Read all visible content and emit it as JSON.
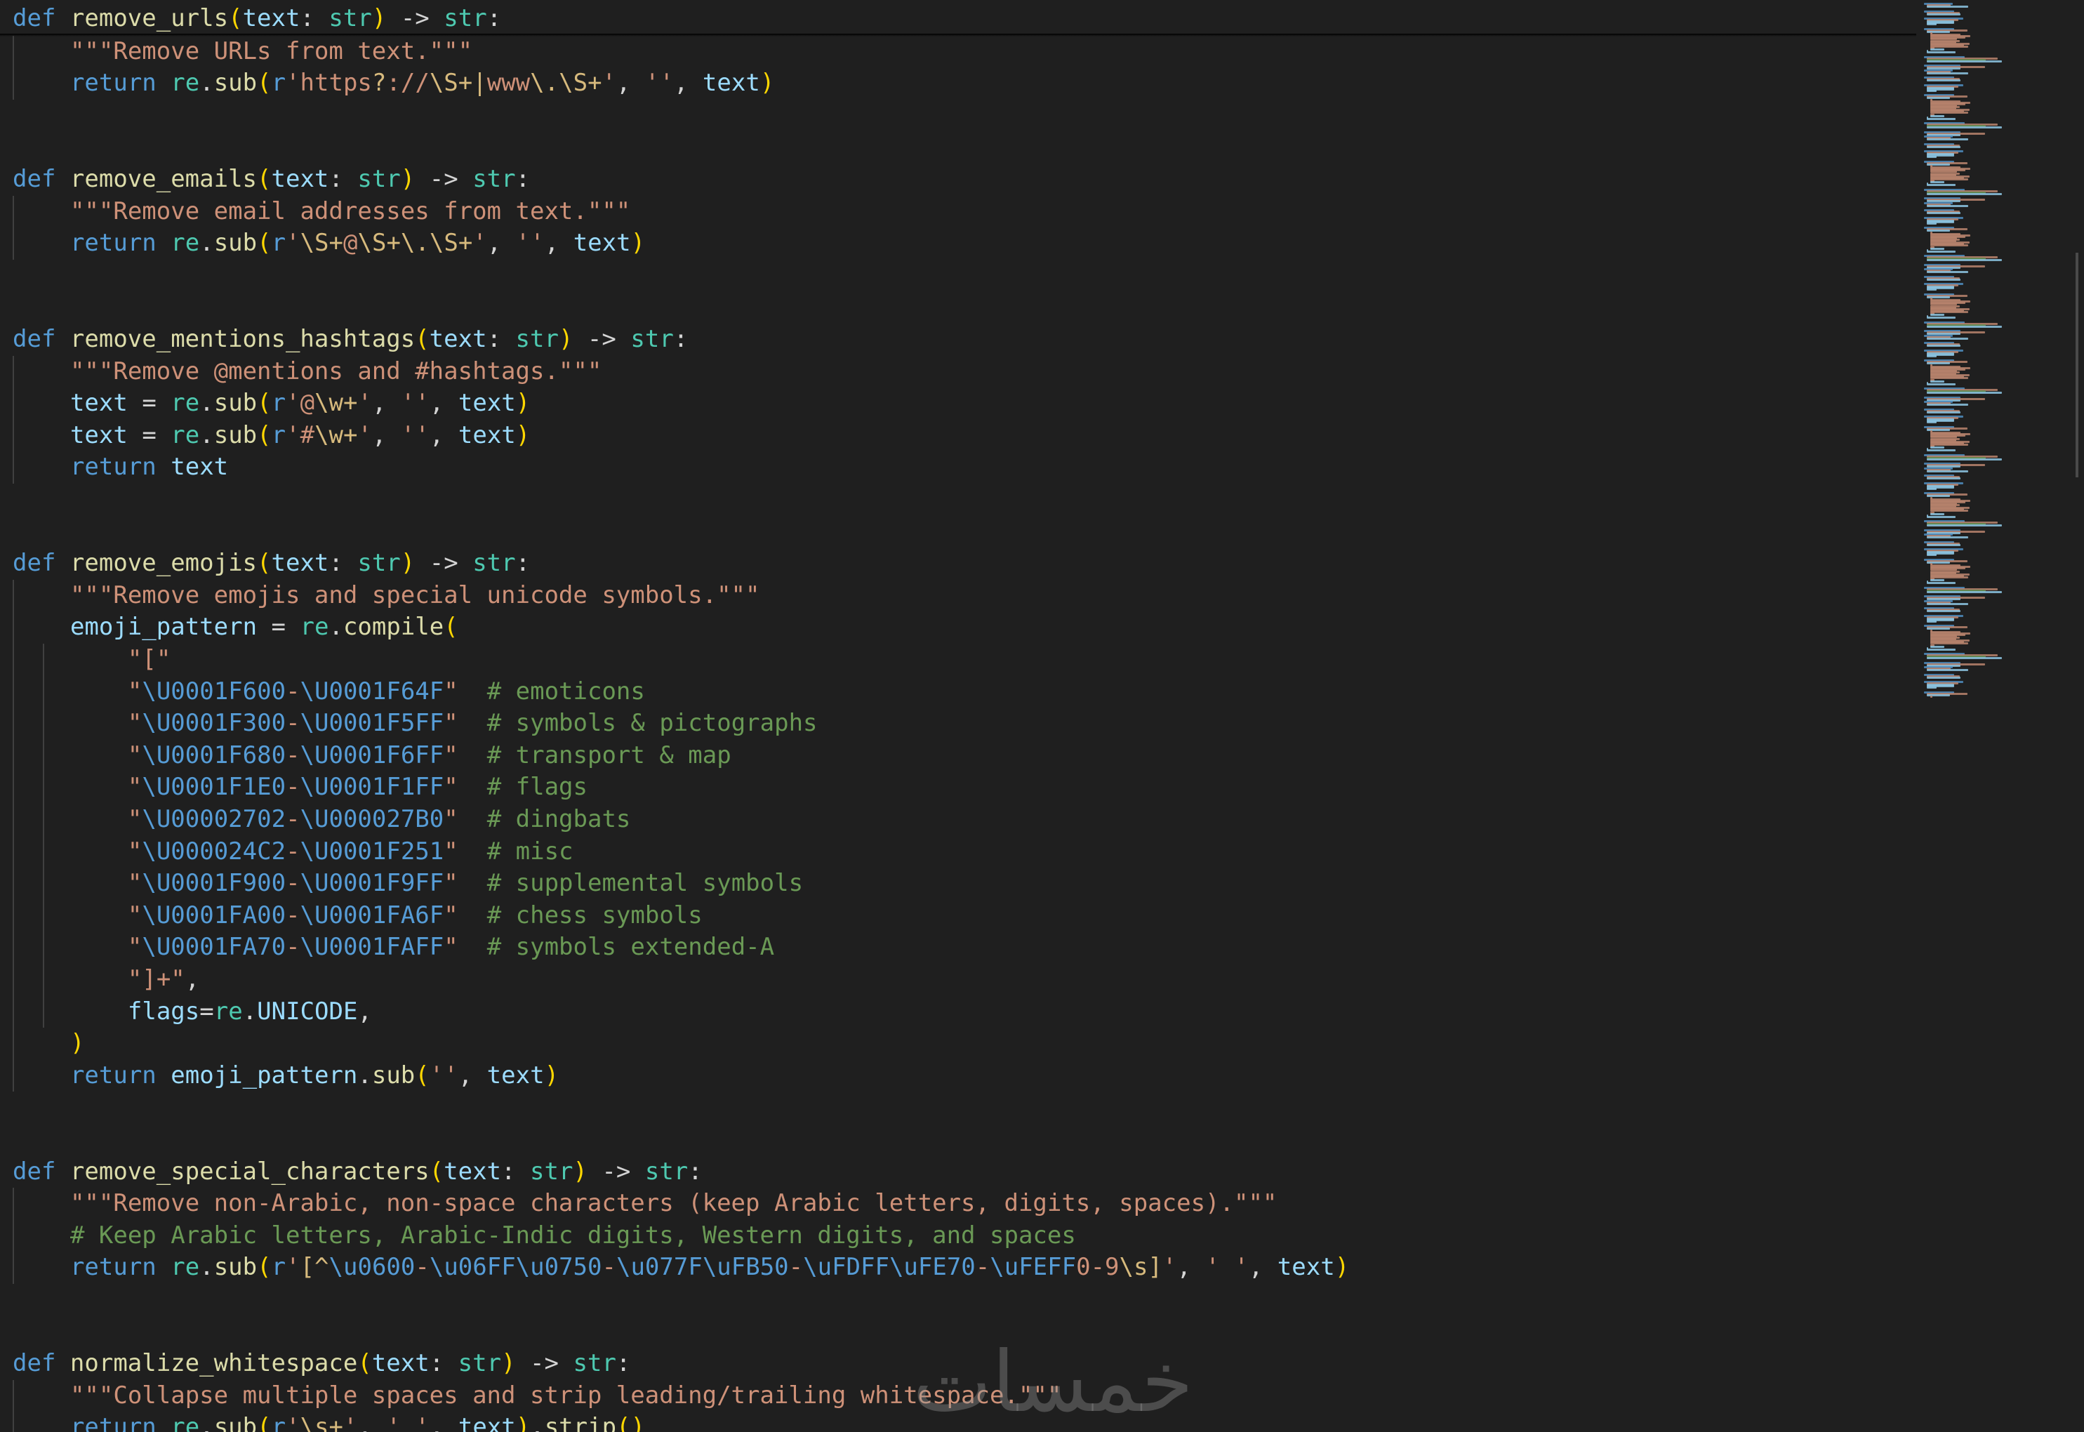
{
  "editor": {
    "language": "python"
  },
  "colors": {
    "keyword": "#569cd6",
    "function": "#dcdcaa",
    "param": "#9cdcfe",
    "type": "#4ec9b0",
    "string": "#ce9178",
    "regex_escape": "#d7ba7d",
    "unicode_escape": "#569cd6",
    "comment": "#6a9955",
    "bracket": "#ffd700",
    "bracket2": "#da70d6",
    "plain": "#d4d4d4"
  },
  "code_lines": [
    "def remove_urls(text: str) -> str:",
    "    \"\"\"Remove URLs from text.\"\"\"",
    "    return re.sub(r'https?://\\S+|www\\.\\S+', '', text)",
    "",
    "",
    "def remove_emails(text: str) -> str:",
    "    \"\"\"Remove email addresses from text.\"\"\"",
    "    return re.sub(r'\\S+@\\S+\\.\\S+', '', text)",
    "",
    "",
    "def remove_mentions_hashtags(text: str) -> str:",
    "    \"\"\"Remove @mentions and #hashtags.\"\"\"",
    "    text = re.sub(r'@\\w+', '', text)",
    "    text = re.sub(r'#\\w+', '', text)",
    "    return text",
    "",
    "",
    "def remove_emojis(text: str) -> str:",
    "    \"\"\"Remove emojis and special unicode symbols.\"\"\"",
    "    emoji_pattern = re.compile(",
    "        \"[\"",
    "        \"\\U0001F600-\\U0001F64F\"  # emoticons",
    "        \"\\U0001F300-\\U0001F5FF\"  # symbols & pictographs",
    "        \"\\U0001F680-\\U0001F6FF\"  # transport & map",
    "        \"\\U0001F1E0-\\U0001F1FF\"  # flags",
    "        \"\\U00002702-\\U000027B0\"  # dingbats",
    "        \"\\U000024C2-\\U0001F251\"  # misc",
    "        \"\\U0001F900-\\U0001F9FF\"  # supplemental symbols",
    "        \"\\U0001FA00-\\U0001FA6F\"  # chess symbols",
    "        \"\\U0001FA70-\\U0001FAFF\"  # symbols extended-A",
    "        \"]+\",",
    "        flags=re.UNICODE,",
    "    )",
    "    return emoji_pattern.sub('', text)",
    "",
    "",
    "def remove_special_characters(text: str) -> str:",
    "    \"\"\"Remove non-Arabic, non-space characters (keep Arabic letters, digits, spaces).\"\"\"",
    "    # Keep Arabic letters, Arabic-Indic digits, Western digits, and spaces",
    "    return re.sub(r'[^\\u0600-\\u06FF\\u0750-\\u077F\\uFB50-\\uFDFF\\uFE70-\\uFEFF0-9\\s]', ' ', text)",
    "",
    "",
    "def normalize_whitespace(text: str) -> str:",
    "    \"\"\"Collapse multiple spaces and strip leading/trailing whitespace.\"\"\"",
    "    return re.sub(r'\\s+', ' ', text).strip()"
  ],
  "watermark": "خمسات"
}
